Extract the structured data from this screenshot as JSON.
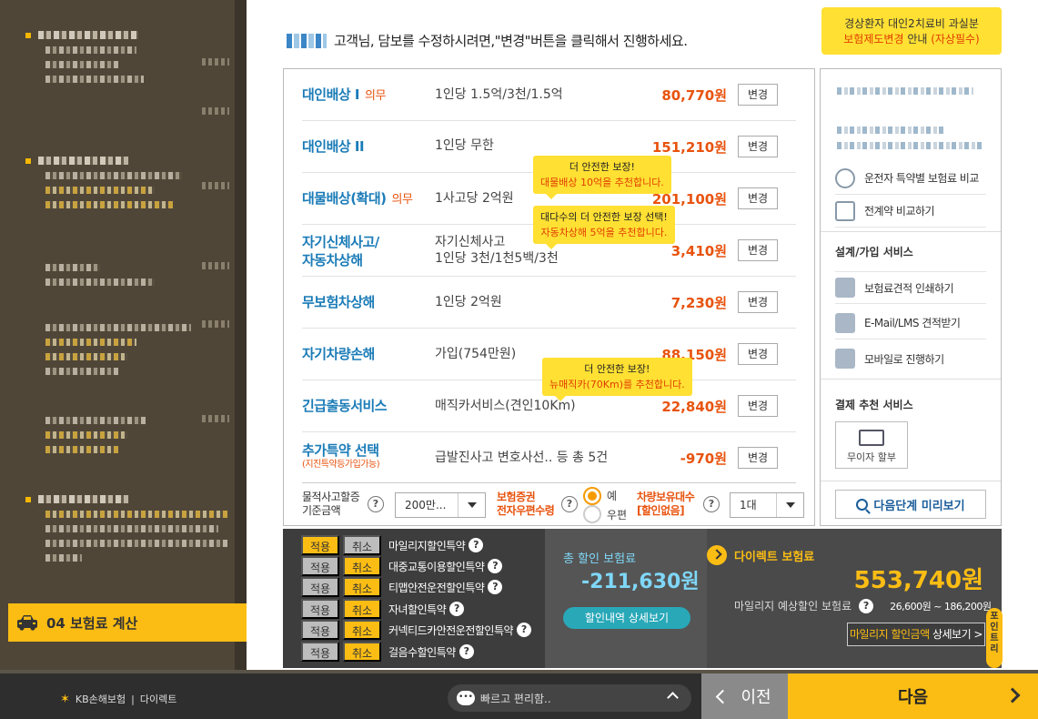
{
  "sidebar": {
    "current_step": "04 보험료 계산"
  },
  "header": {
    "message": "고객님, 담보를 수정하시려면,\"변경\"버튼을 클릭해서 진행하세요."
  },
  "notice": {
    "line1": "경상환자 대인2치료비 과실분",
    "line2_red": "보험제도변경",
    "line2_mid": " 안내 ",
    "line2_paren": "(자상필수)"
  },
  "coverages": [
    {
      "name": "대인배상 I",
      "required": "의무",
      "desc": "1인당 1.5억/3천/1.5억",
      "price": "80,770원",
      "button": "변경"
    },
    {
      "name": "대인배상 II",
      "required": "",
      "desc": "1인당 무한",
      "price": "151,210원",
      "button": "변경"
    },
    {
      "name": "대물배상(확대)",
      "required": "의무",
      "desc": "1사고당 2억원",
      "price": "201,100원",
      "button": "변경"
    },
    {
      "name": "자기신체사고/",
      "name2": "자동차상해",
      "required": "",
      "desc": "자기신체사고",
      "desc2": "1인당 3천/1천5백/3천",
      "price": "3,410원",
      "button": "변경"
    },
    {
      "name": "무보험차상해",
      "required": "",
      "desc": "1인당 2억원",
      "price": "7,230원",
      "button": "변경"
    },
    {
      "name": "자기차량손해",
      "required": "",
      "desc": "가입(754만원)",
      "price": "88,150원",
      "button": "변경"
    },
    {
      "name": "긴급출동서비스",
      "required": "",
      "desc": "매직카서비스(견인10Km)",
      "price": "22,840원",
      "button": "변경"
    },
    {
      "name": "추가특약 선택",
      "sub": "(지진특약등가입가능)",
      "required": "",
      "desc": "급발진사고 변호사선.. 등 총 5건",
      "price": "-970원",
      "button": "변경"
    }
  ],
  "tooltips": {
    "t1_line1": "더 안전한 보장!",
    "t1_line2": "대물배상 10억을 추천합니다.",
    "t2_line1": "대다수의 더 안전한 보장 선택!",
    "t2_line2": "자동차상해 5억을 추천합니다.",
    "t3_line1": "더 안전한 보장!",
    "t3_line2": "뉴매직카(70Km)를 추천합니다."
  },
  "coverage_footer": {
    "label1_a": "물적사고할증",
    "label1_b": "기준금액",
    "select1": "200만...",
    "label2_a": "보험증권",
    "label2_b": "전자우편수령",
    "radio_yes": "예",
    "radio_no": "우편",
    "label3_a": "차량보유대수",
    "label3_b": "[할인없음]",
    "select3": "1대"
  },
  "right_panel": {
    "compare_driver": "운전자 특약별 보험료 비교",
    "compare_prev": "전계약 비교하기",
    "section_service": "설계/가입 서비스",
    "print": "보험료견적 인쇄하기",
    "email": "E-Mail/LMS 견적받기",
    "mobile": "모바일로 진행하기",
    "section_payment": "결제 추천 서비스",
    "no_interest": "무이자 할부",
    "preview": "다음단계 미리보기"
  },
  "discounts": {
    "apply": "적용",
    "cancel": "취소",
    "items": [
      "마일리지할인특약",
      "대중교통이용할인특약",
      "티맵안전운전할인특약",
      "자녀할인특약",
      "커넥티드카안전운전할인특약",
      "걸음수할인특약"
    ],
    "total_label": "총 할인 보험료",
    "total_value": "-211,630원",
    "detail_button": "할인내역 상세보기",
    "direct_label": "다이렉트 보험료",
    "direct_value": "553,740원",
    "mileage_label": "마일리지 예상할인 보험료",
    "mileage_range": "26,600원 ~ 186,200원",
    "mileage_btn_a": "마일리지 할인금액",
    "mileage_btn_b": " 상세보기 >",
    "point_tab": "포인트리"
  },
  "bottom": {
    "brand": "KB손해보험",
    "brand_sub": "다이렉트",
    "chat": "빠르고 편리함..",
    "prev": "이전",
    "next": "다음"
  }
}
